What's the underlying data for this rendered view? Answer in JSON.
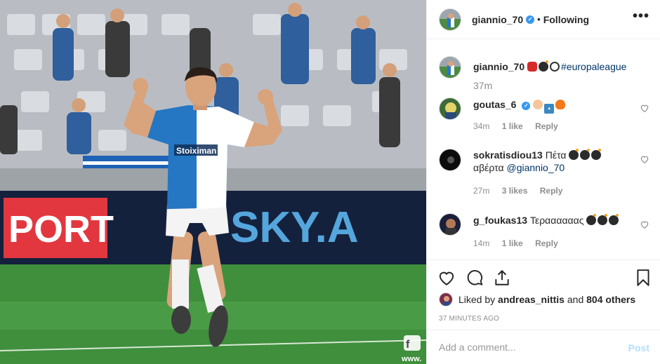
{
  "post": {
    "username": "giannio_70",
    "follow_state": "Following",
    "more_icon": "more-horizontal-icon"
  },
  "photo": {
    "banner_left_text": "PORT",
    "banner_right_text": "SKY.A",
    "jersey_sponsor": "Stoiximan",
    "watermark": "www."
  },
  "caption": {
    "username": "giannio_70",
    "emojis": [
      "boxing-glove",
      "bomb",
      "soccer-ball"
    ],
    "hashtag": "#europaleague",
    "time": "37m"
  },
  "comments": [
    {
      "username": "goutas_6",
      "verified": true,
      "text": "",
      "emojis": [
        "clapping-hands",
        "top-arrow",
        "fire"
      ],
      "time": "34m",
      "likes": "1 like",
      "reply": "Reply"
    },
    {
      "username": "sokratisdiou13",
      "text_before": "Πέτα",
      "emojis": [
        "bomb",
        "bomb",
        "bomb"
      ],
      "text_line2": "αβέρτα",
      "mention": "@giannio_70",
      "time": "27m",
      "likes": "3 likes",
      "reply": "Reply"
    },
    {
      "username": "g_foukas13",
      "text": "Τεραααααας",
      "emojis": [
        "bomb",
        "bomb",
        "bomb"
      ],
      "time": "14m",
      "likes": "1 like",
      "reply": "Reply"
    }
  ],
  "actions": {
    "liked_by_prefix": "Liked by",
    "liked_by_user": "andreas_nittis",
    "liked_by_and": "and",
    "liked_by_others": "804 others",
    "timestamp": "37 MINUTES AGO"
  },
  "composer": {
    "placeholder": "Add a comment...",
    "post_label": "Post"
  },
  "colors": {
    "accent": "#3897f0",
    "link": "#003569",
    "muted": "#8e8e8e",
    "post_disabled": "#b2dffc"
  }
}
